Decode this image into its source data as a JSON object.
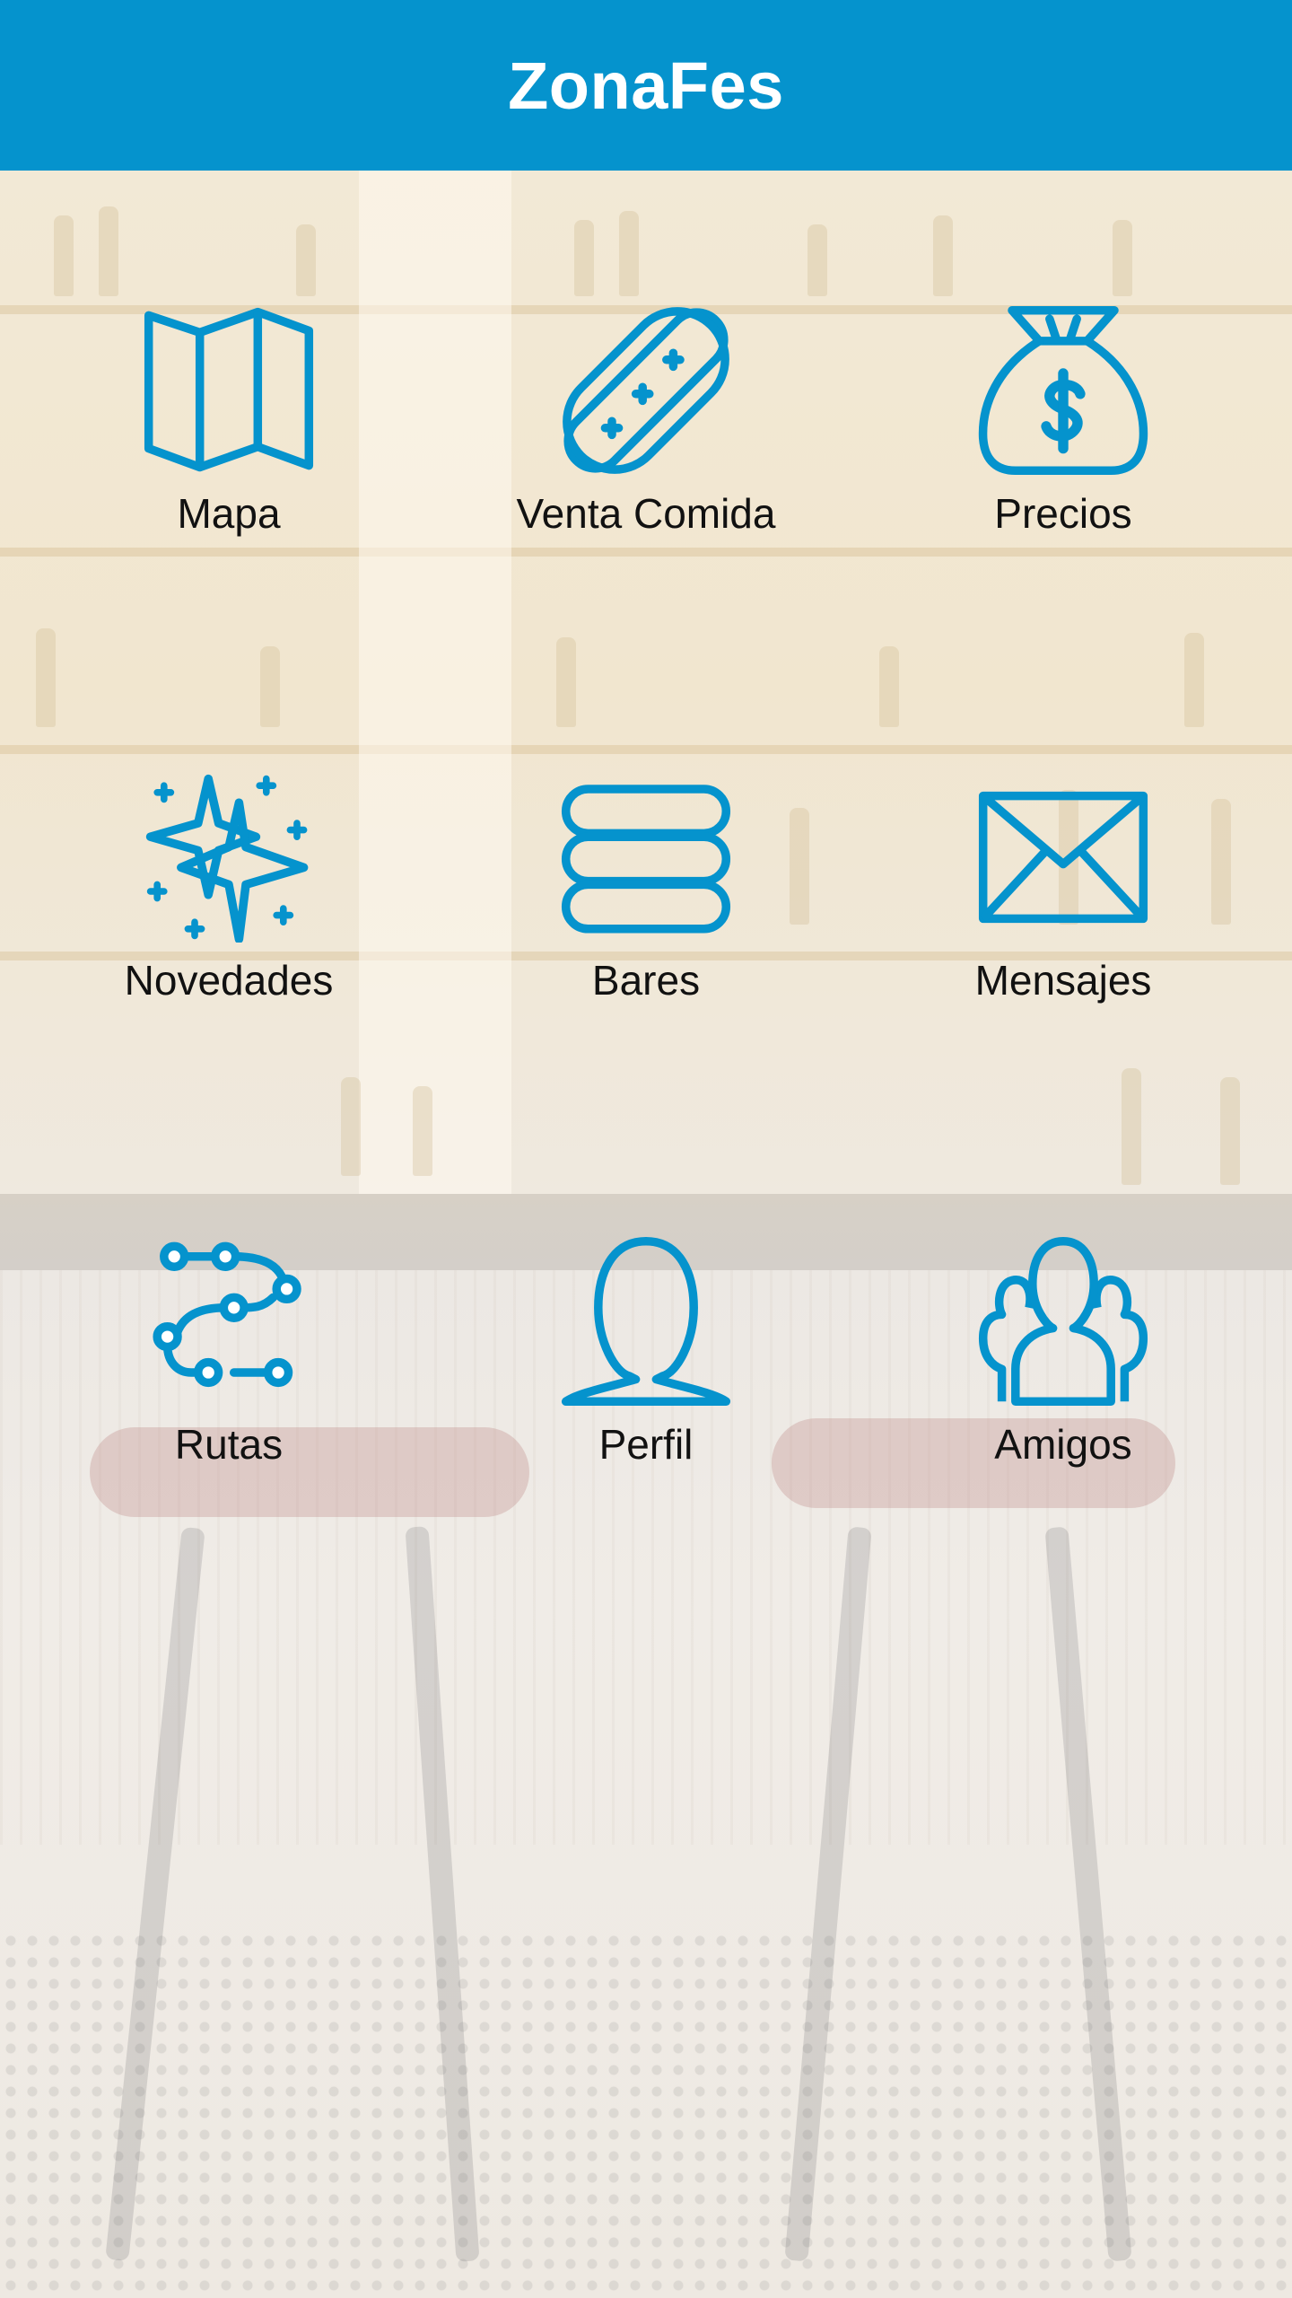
{
  "app": {
    "title": "ZonaFes"
  },
  "theme": {
    "primary": "#0593cd",
    "icon_color": "#0593cd",
    "label_color": "#111111"
  },
  "menu": [
    {
      "label": "Mapa",
      "icon": "map-icon"
    },
    {
      "label": "Venta Comida",
      "icon": "hotdog-icon"
    },
    {
      "label": "Precios",
      "icon": "money-bag-icon"
    },
    {
      "label": "Novedades",
      "icon": "sparkles-icon"
    },
    {
      "label": "Bares",
      "icon": "stack-icon"
    },
    {
      "label": "Mensajes",
      "icon": "envelope-icon"
    },
    {
      "label": "Rutas",
      "icon": "route-icon"
    },
    {
      "label": "Perfil",
      "icon": "person-icon"
    },
    {
      "label": "Amigos",
      "icon": "group-icon"
    }
  ]
}
